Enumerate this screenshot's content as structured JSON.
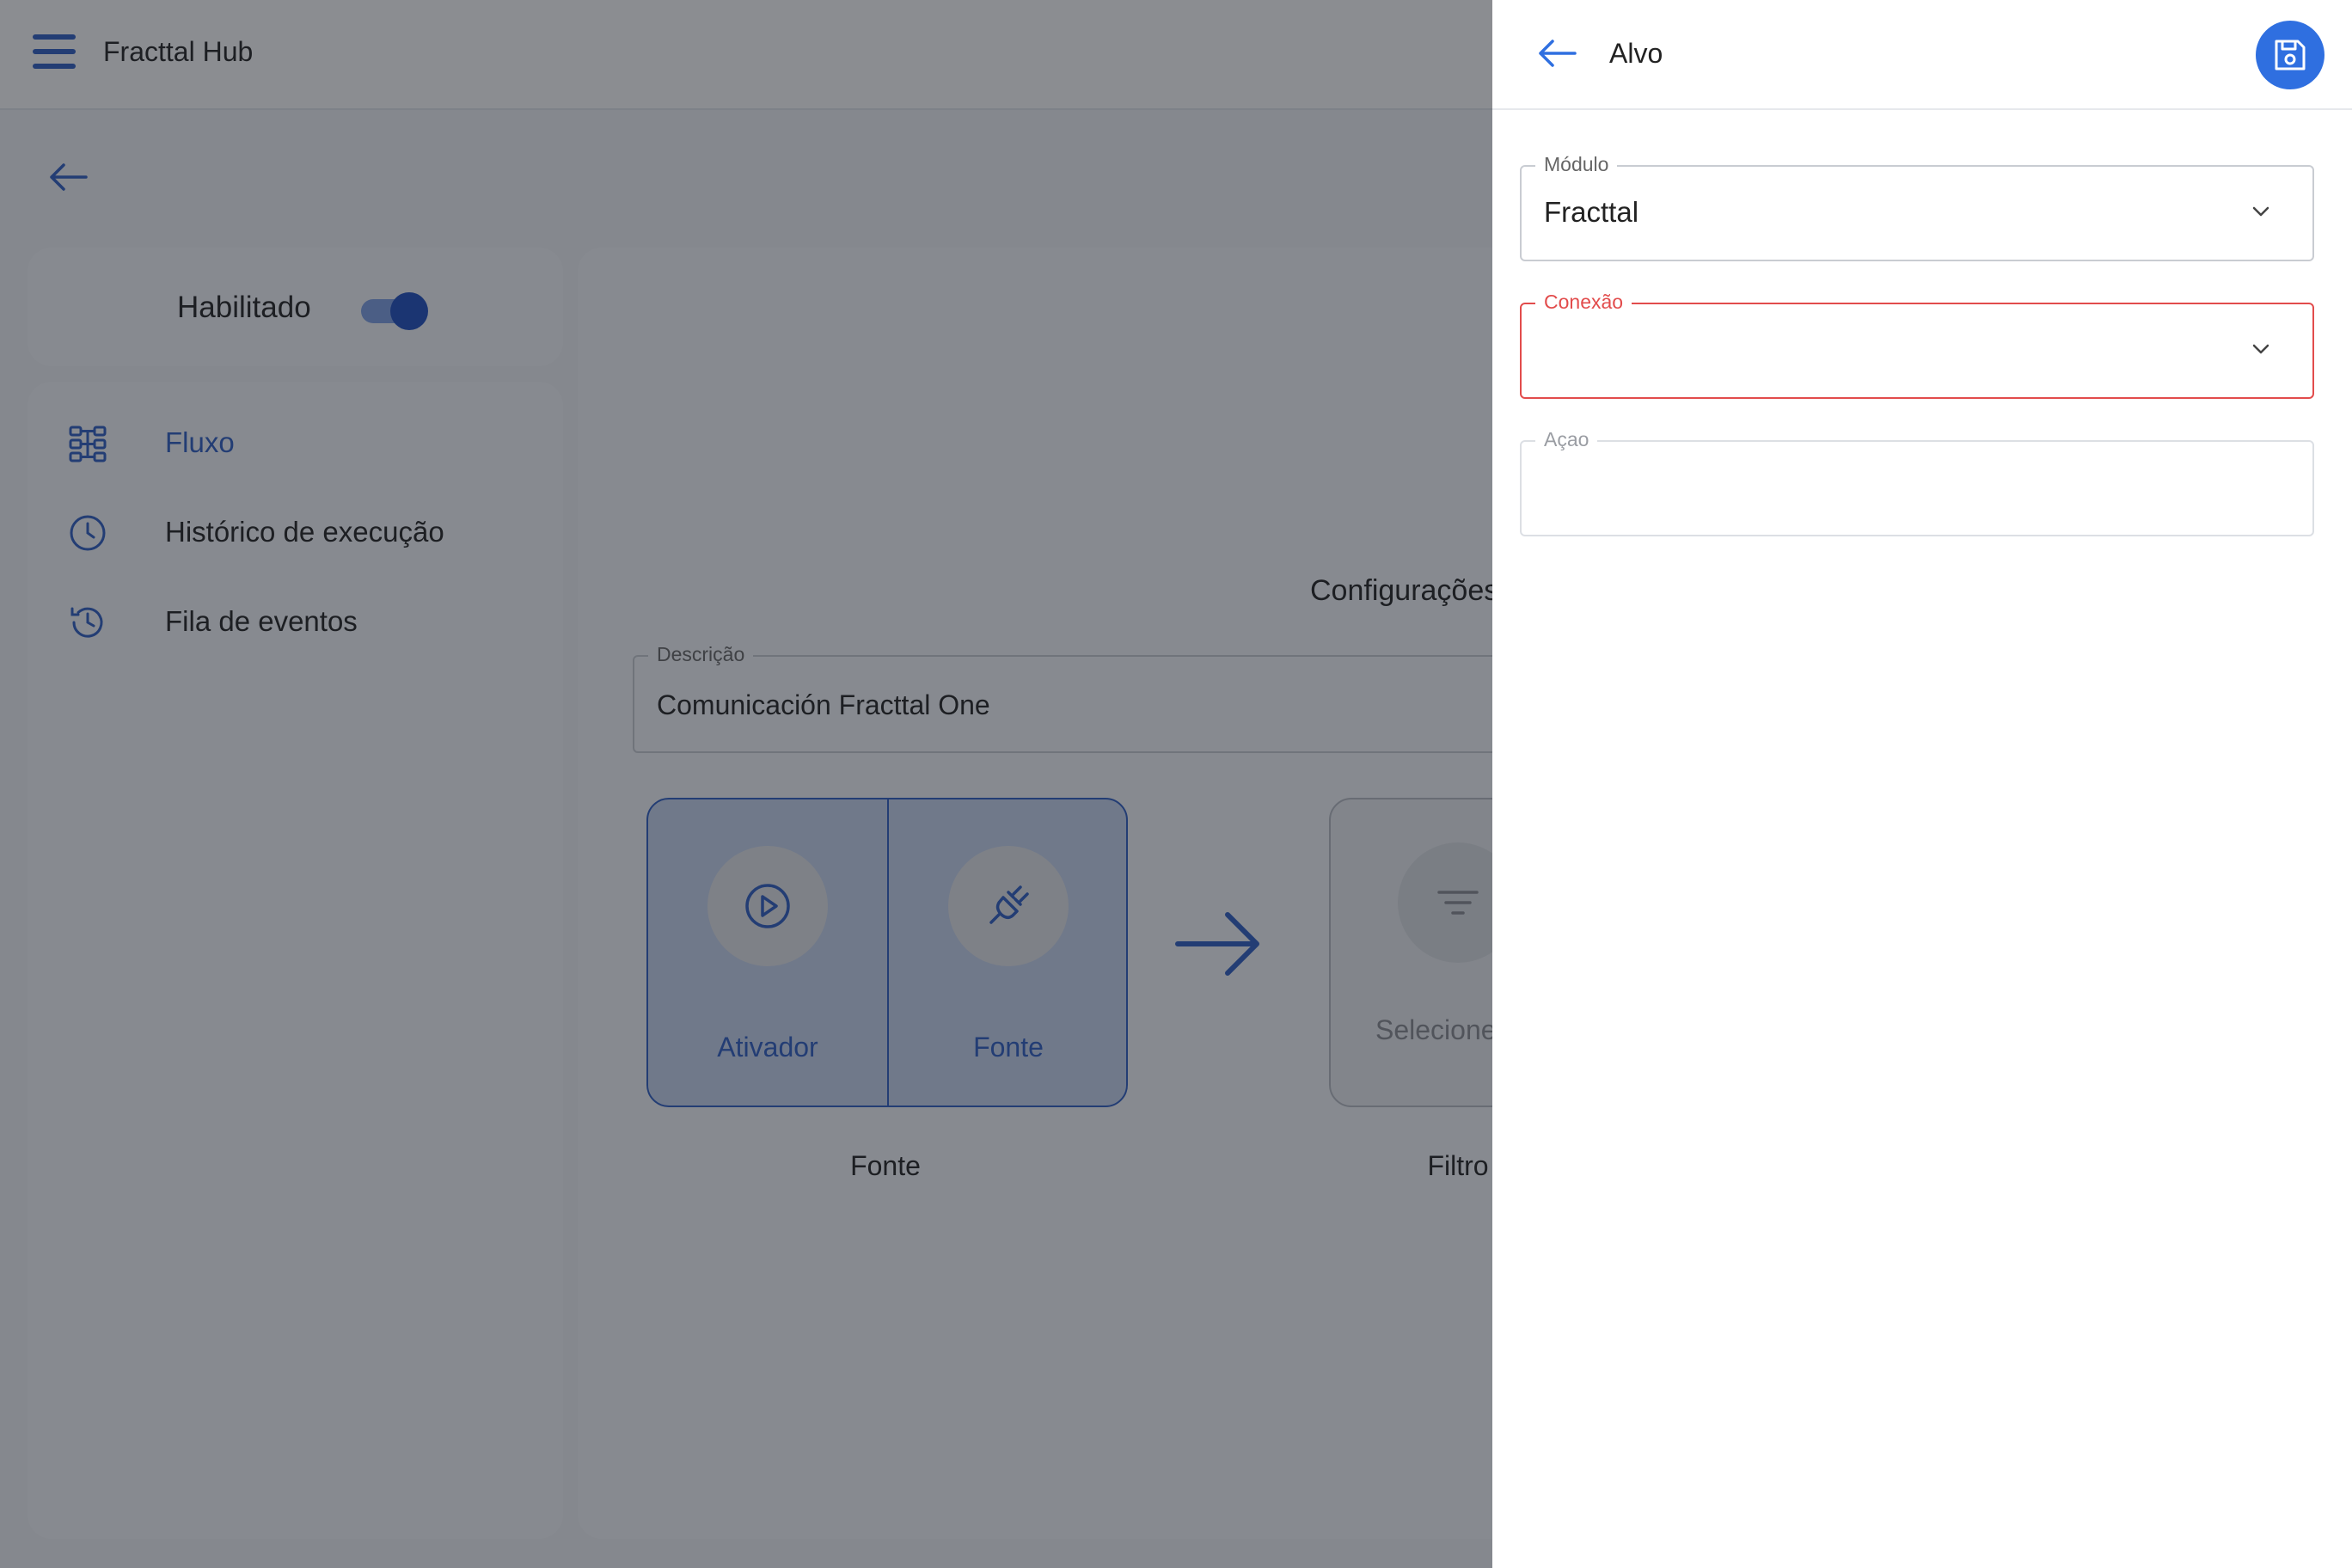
{
  "app": {
    "title": "Fracttal Hub"
  },
  "sidebar": {
    "enabled_label": "Habilitado",
    "enabled": true,
    "items": [
      {
        "label": "Fluxo",
        "icon": "flow-icon",
        "active": true
      },
      {
        "label": "Histórico de execução",
        "icon": "clock-icon",
        "active": false
      },
      {
        "label": "Fila de eventos",
        "icon": "history-icon",
        "active": false
      }
    ]
  },
  "main": {
    "config_title": "Configurações",
    "description": {
      "label": "Descrição",
      "value": "Comunicación Fracttal One"
    },
    "flow": {
      "source": {
        "trigger_label": "Ativador",
        "source_label": "Fonte",
        "caption": "Fonte"
      },
      "filter": {
        "button_label": "Selecione",
        "caption": "Filtro"
      }
    }
  },
  "panel": {
    "title": "Alvo",
    "fields": {
      "module": {
        "label": "Módulo",
        "value": "Fracttal"
      },
      "connection": {
        "label": "Conexão",
        "value": ""
      },
      "action": {
        "label": "Açao",
        "value": ""
      }
    }
  },
  "colors": {
    "primary": "#2f5fc4",
    "save_button": "#2f6fe0",
    "error": "#e24c4c",
    "overlay": "rgba(24,28,36,0.5)"
  }
}
